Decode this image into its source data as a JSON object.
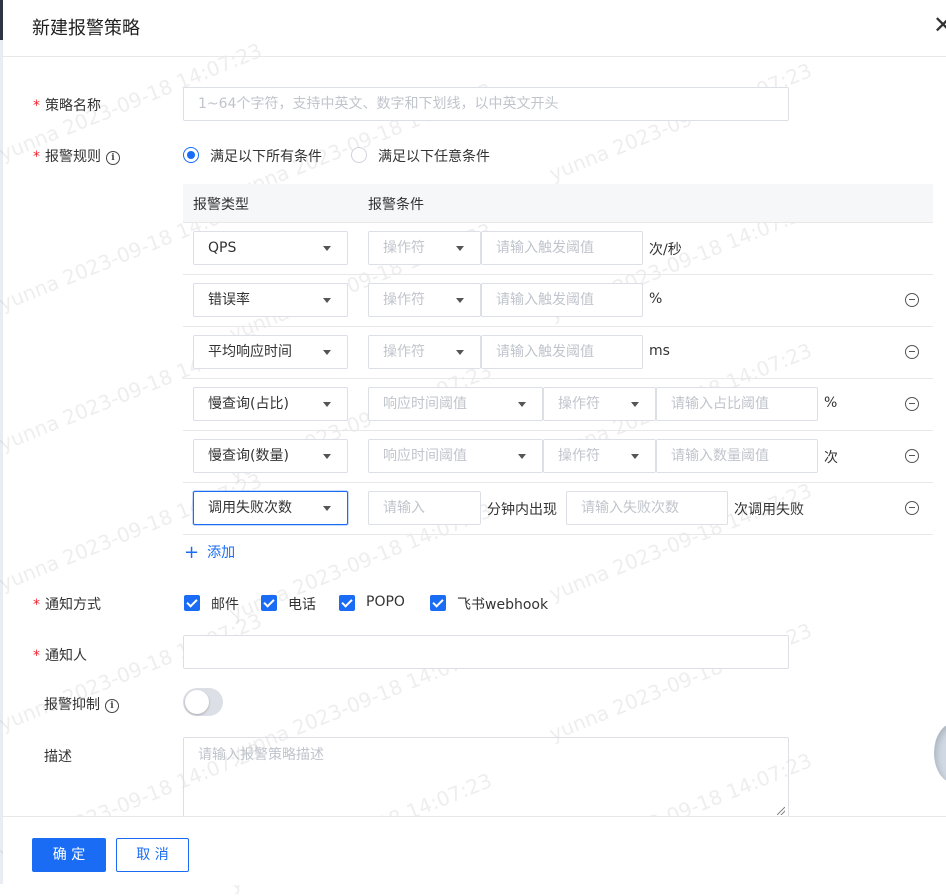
{
  "dialog": {
    "title": "新建报警策略"
  },
  "watermark": {
    "text": "yunna 2023-09-18 14:07:23"
  },
  "form": {
    "name": {
      "label": "策略名称",
      "placeholder": "1~64个字符，支持中英文、数字和下划线，以中英文开头"
    },
    "rules": {
      "label": "报警规则",
      "match_options": [
        "满足以下所有条件",
        "满足以下任意条件"
      ],
      "selected_match": "满足以下所有条件",
      "columns": [
        "报警类型",
        "报警条件"
      ],
      "rows": [
        {
          "type": "QPS",
          "operator": "操作符",
          "value_placeholder": "请输入触发阈值",
          "unit": "次/秒"
        },
        {
          "type": "错误率",
          "operator": "操作符",
          "value_placeholder": "请输入触发阈值",
          "unit": "%"
        },
        {
          "type": "平均响应时间",
          "operator": "操作符",
          "value_placeholder": "请输入触发阈值",
          "unit": "ms"
        },
        {
          "type": "慢查询(占比)",
          "threshold": "响应时间阈值",
          "operator": "操作符",
          "value_placeholder": "请输入占比阈值",
          "unit": "%"
        },
        {
          "type": "慢查询(数量)",
          "threshold": "响应时间阈值",
          "operator": "操作符",
          "value_placeholder": "请输入数量阈值",
          "unit": "次"
        },
        {
          "type": "调用失败次数",
          "minutes_placeholder": "请输入",
          "middle_text": "分钟内出现",
          "value_placeholder": "请输入失败次数",
          "unit": "次调用失败"
        }
      ],
      "add_label": "添加"
    },
    "notify_method": {
      "label": "通知方式",
      "options": [
        "邮件",
        "电话",
        "POPO",
        "飞书webhook"
      ],
      "checked": [
        true,
        true,
        true,
        true
      ]
    },
    "notify_people": {
      "label": "通知人",
      "value": ""
    },
    "suppress": {
      "label": "报警抑制",
      "enabled": false
    },
    "description": {
      "label": "描述",
      "placeholder": "请输入报警策略描述"
    }
  },
  "footer": {
    "confirm": "确 定",
    "cancel": "取 消"
  },
  "colors": {
    "primary": "#1a6cf5",
    "required": "#f5222d",
    "border": "#dcdfe6",
    "placeholder": "#c0c4cc"
  }
}
